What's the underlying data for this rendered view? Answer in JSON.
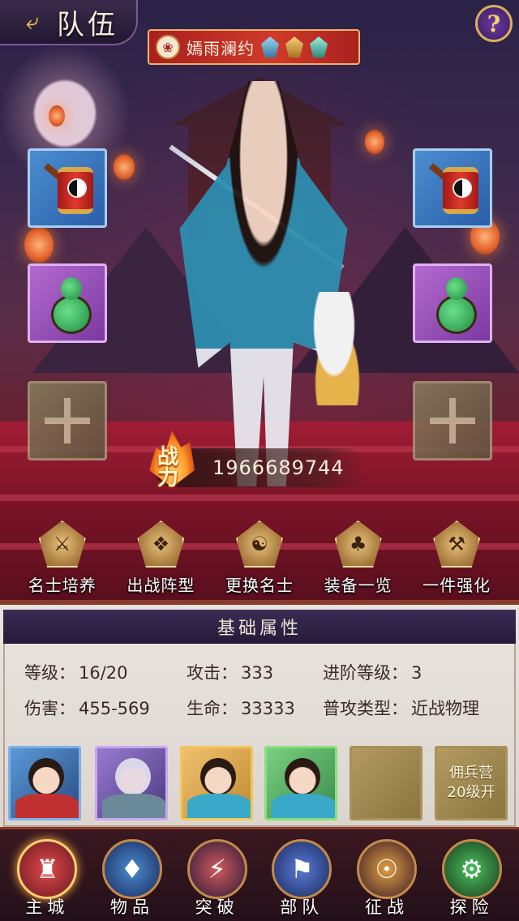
{
  "header": {
    "back_icon": "back-arrow-icon",
    "title": "队伍",
    "help_label": "?"
  },
  "hero": {
    "name": "嫣雨澜约",
    "emblem_icon": "clan-emblem-icon",
    "star_gems": [
      "blue-gem",
      "gold-gem",
      "teal-gem"
    ],
    "power_label": "战力",
    "power_value": "1966689744"
  },
  "equipment": {
    "left": [
      "taiji-drum",
      "jade-gourd",
      "empty-slot"
    ],
    "right": [
      "taiji-drum",
      "jade-gourd",
      "empty-slot"
    ]
  },
  "actions": [
    {
      "label": "名士培养",
      "icon": "sword-upgrade-icon"
    },
    {
      "label": "出战阵型",
      "icon": "formation-icon"
    },
    {
      "label": "更换名士",
      "icon": "swap-hero-icon"
    },
    {
      "label": "装备一览",
      "icon": "equipment-list-icon"
    },
    {
      "label": "一件强化",
      "icon": "anvil-icon"
    }
  ],
  "attributes": {
    "title": "基础属性",
    "level_label": "等级：",
    "level_value": "16/20",
    "attack_label": "攻击：",
    "attack_value": "333",
    "advance_label": "进阶等级：",
    "advance_value": "3",
    "damage_label": "伤害：",
    "damage_value": "455-569",
    "hp_label": "生命：",
    "hp_value": "33333",
    "attack_type_label": "普攻类型：",
    "attack_type_value": "近战物理"
  },
  "team": {
    "locked_slot_line1": "佣兵营",
    "locked_slot_line2": "20级开"
  },
  "bottom_nav": [
    {
      "label": "主城",
      "icon": "castle-icon",
      "active": true
    },
    {
      "label": "物品",
      "icon": "bag-icon",
      "active": false
    },
    {
      "label": "突破",
      "icon": "breakthrough-icon",
      "active": false
    },
    {
      "label": "部队",
      "icon": "army-icon",
      "active": false
    },
    {
      "label": "征战",
      "icon": "battle-icon",
      "active": false
    },
    {
      "label": "探险",
      "icon": "explore-icon",
      "active": false
    }
  ],
  "colors": {
    "accent_gold": "#d9b05a",
    "banner_red": "#c03028",
    "panel_header": "#2f2446",
    "slot_blue": "#3c78c0",
    "slot_purple": "#9c52c0"
  }
}
